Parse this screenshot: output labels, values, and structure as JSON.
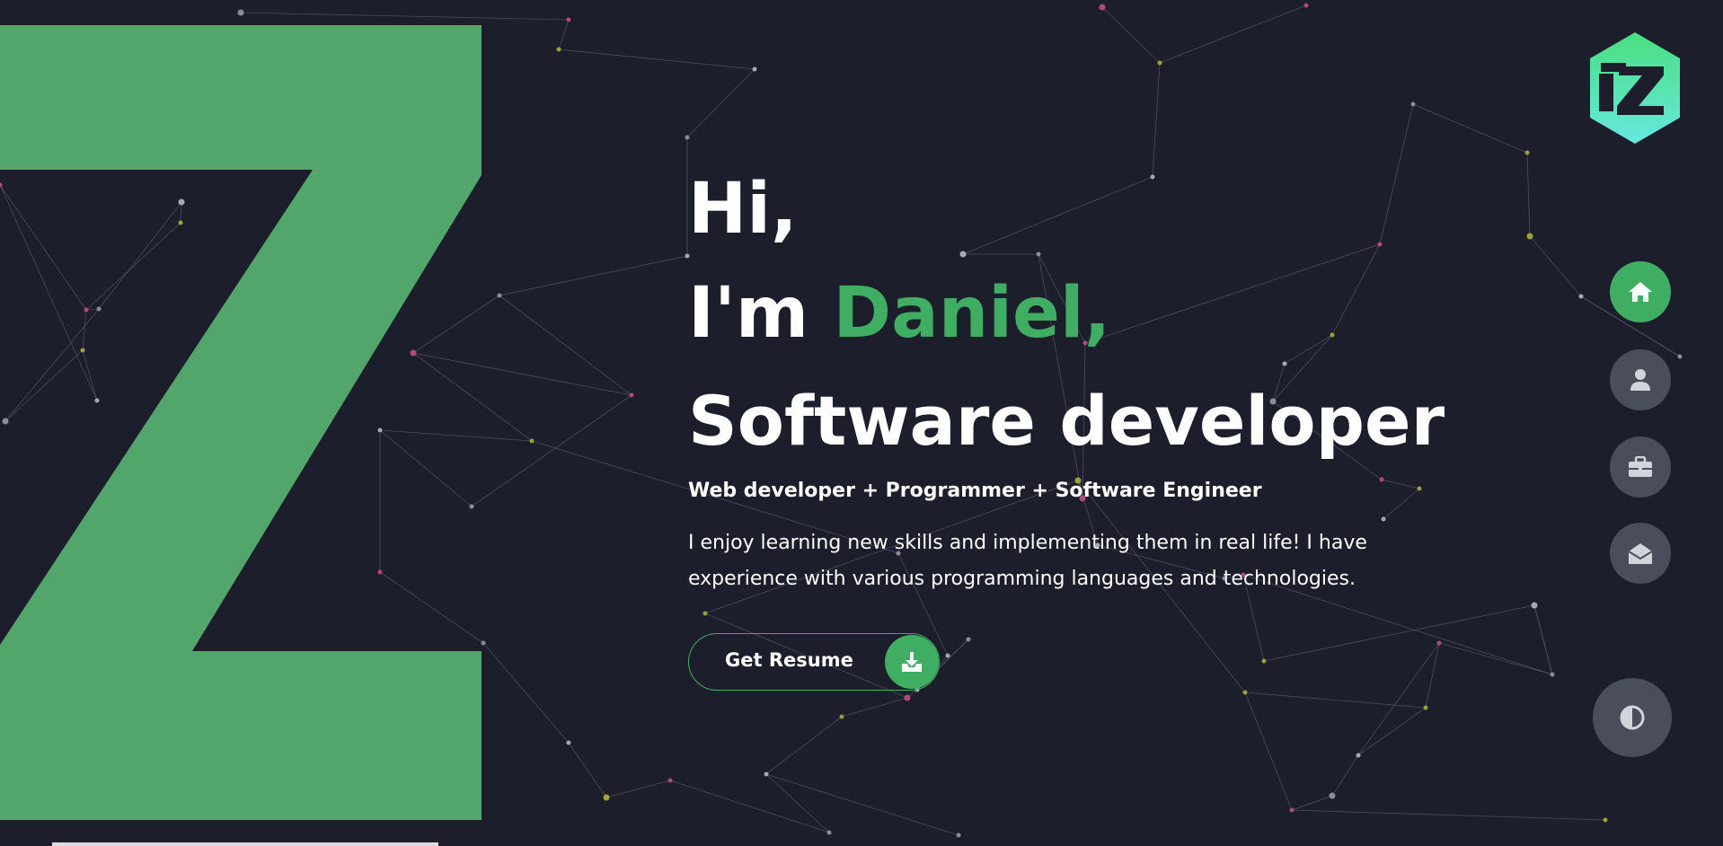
{
  "hero": {
    "greeting": "Hi,",
    "intro_prefix": "I'm ",
    "name": "Daniel,",
    "role": "Software developer",
    "subtitle": "Web developer + Programmer + Software Engineer",
    "description": "I enjoy learning new skills and implementing them in real life! I have experience with various programming languages and technologies."
  },
  "resume_button": {
    "label": "Get Resume",
    "icon": "download-icon"
  },
  "logo": {
    "icon": "hexagon-logo",
    "letter": "Z"
  },
  "nav": [
    {
      "id": "home",
      "icon": "home-icon",
      "active": true
    },
    {
      "id": "about",
      "icon": "user-icon",
      "active": false
    },
    {
      "id": "portfolio",
      "icon": "briefcase-icon",
      "active": false
    },
    {
      "id": "contact",
      "icon": "envelope-open-icon",
      "active": false
    }
  ],
  "theme_toggle": {
    "icon": "contrast-icon"
  },
  "colors": {
    "background": "#1c1e2c",
    "accent": "#3fae62",
    "big_letter": "#52a56b",
    "nav_inactive": "#4a4d5a",
    "logo_top": "#4ade80",
    "logo_bottom": "#67e8e0"
  }
}
